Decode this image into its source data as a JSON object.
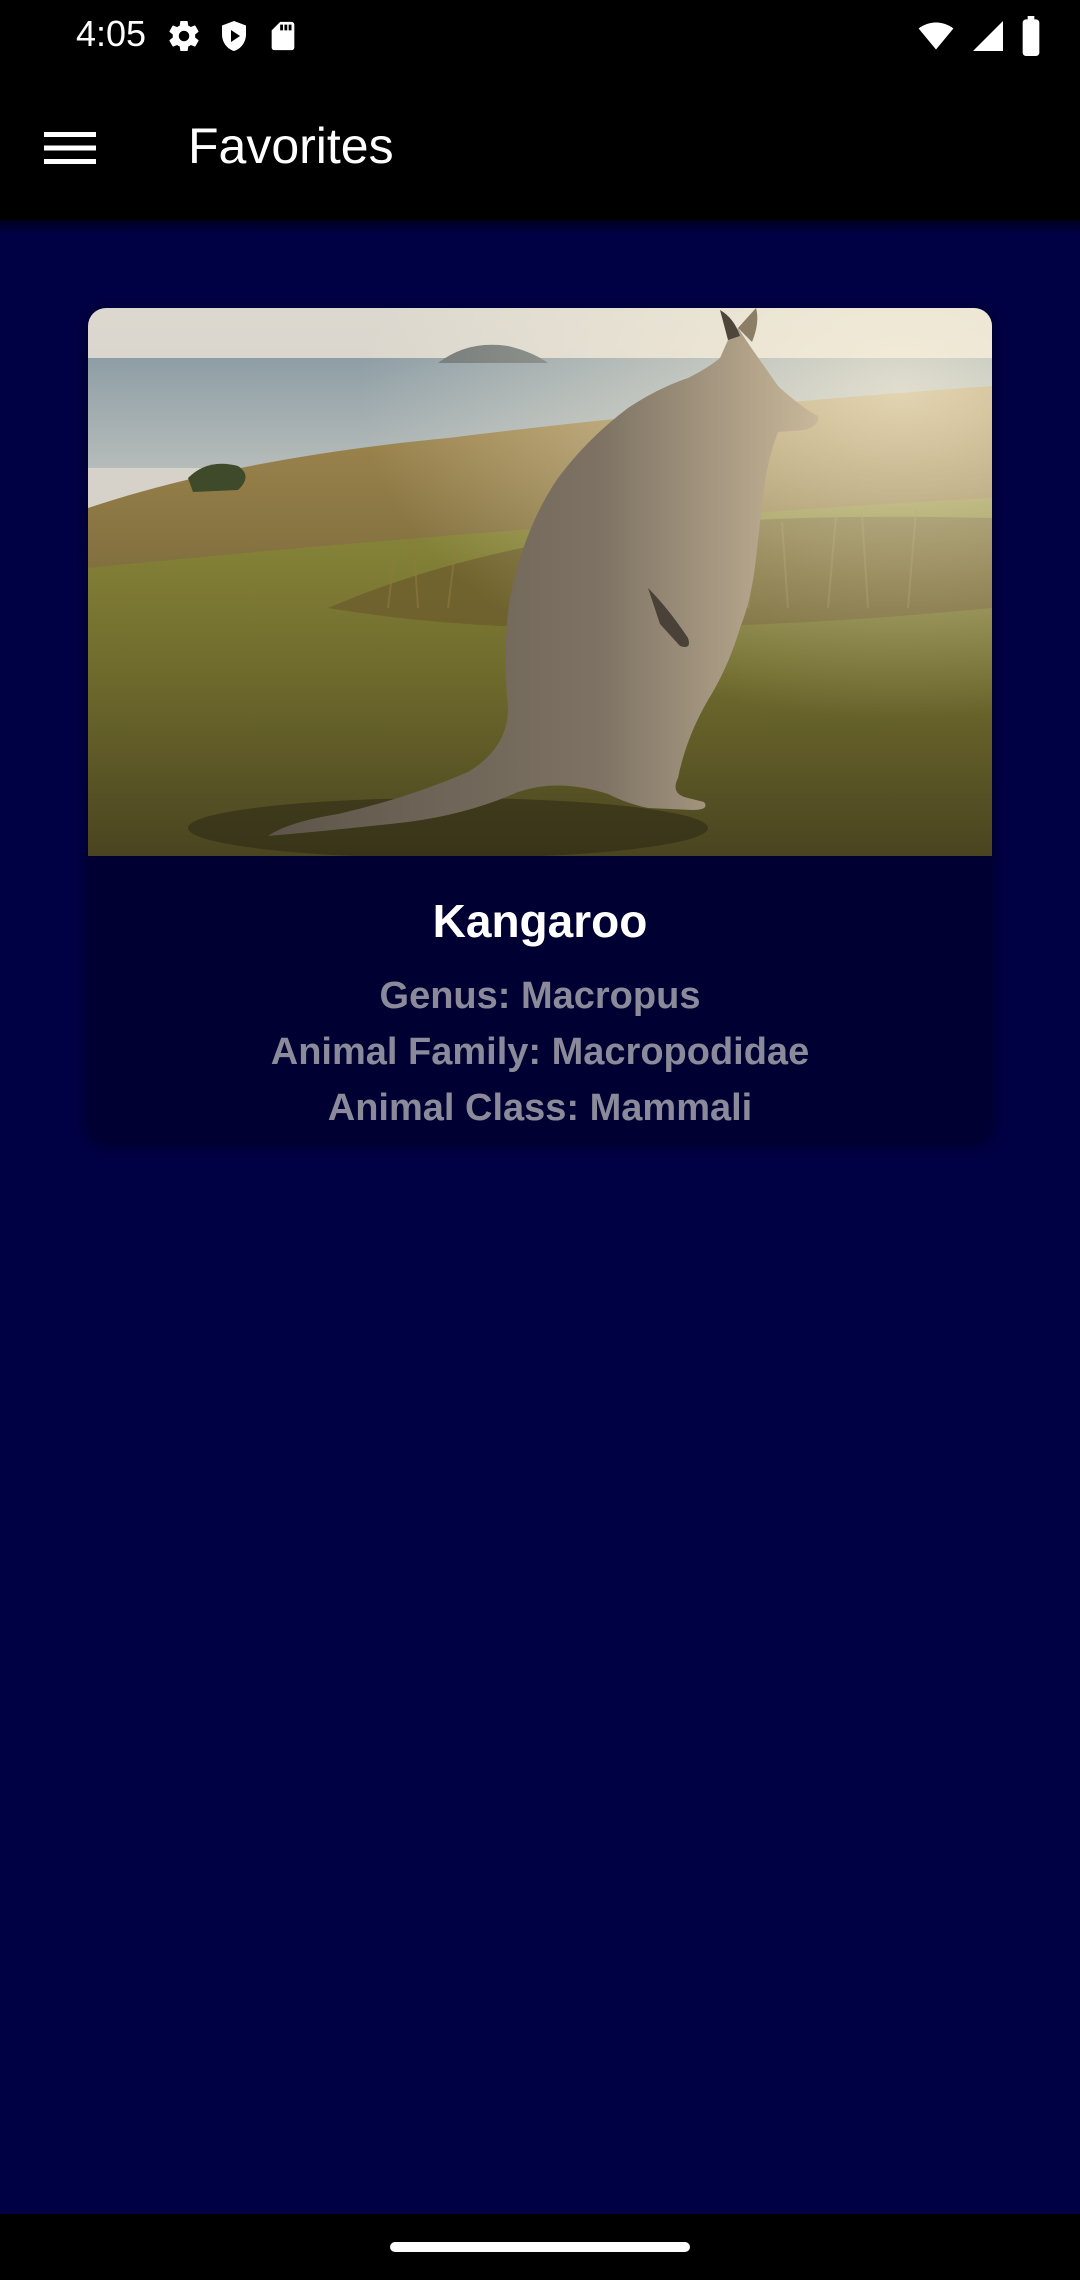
{
  "status_bar": {
    "time": "4:05",
    "left_icons": [
      "settings-icon",
      "shield-play-icon",
      "sd-card-icon"
    ],
    "right_icons": [
      "wifi-icon",
      "cellular-signal-icon",
      "battery-icon"
    ]
  },
  "app_bar": {
    "menu_icon": "menu-icon",
    "title": "Favorites"
  },
  "favorites": [
    {
      "image": "kangaroo-photo",
      "name": "Kangaroo",
      "genus": "Genus: Macropus",
      "family": "Animal Family: Macropodidae",
      "class": "Animal Class: Mammali"
    }
  ],
  "colors": {
    "background": "#000044",
    "bars": "#000000",
    "card": "#000033",
    "title_text": "#ffffff",
    "info_text": "#8a8a9a"
  }
}
